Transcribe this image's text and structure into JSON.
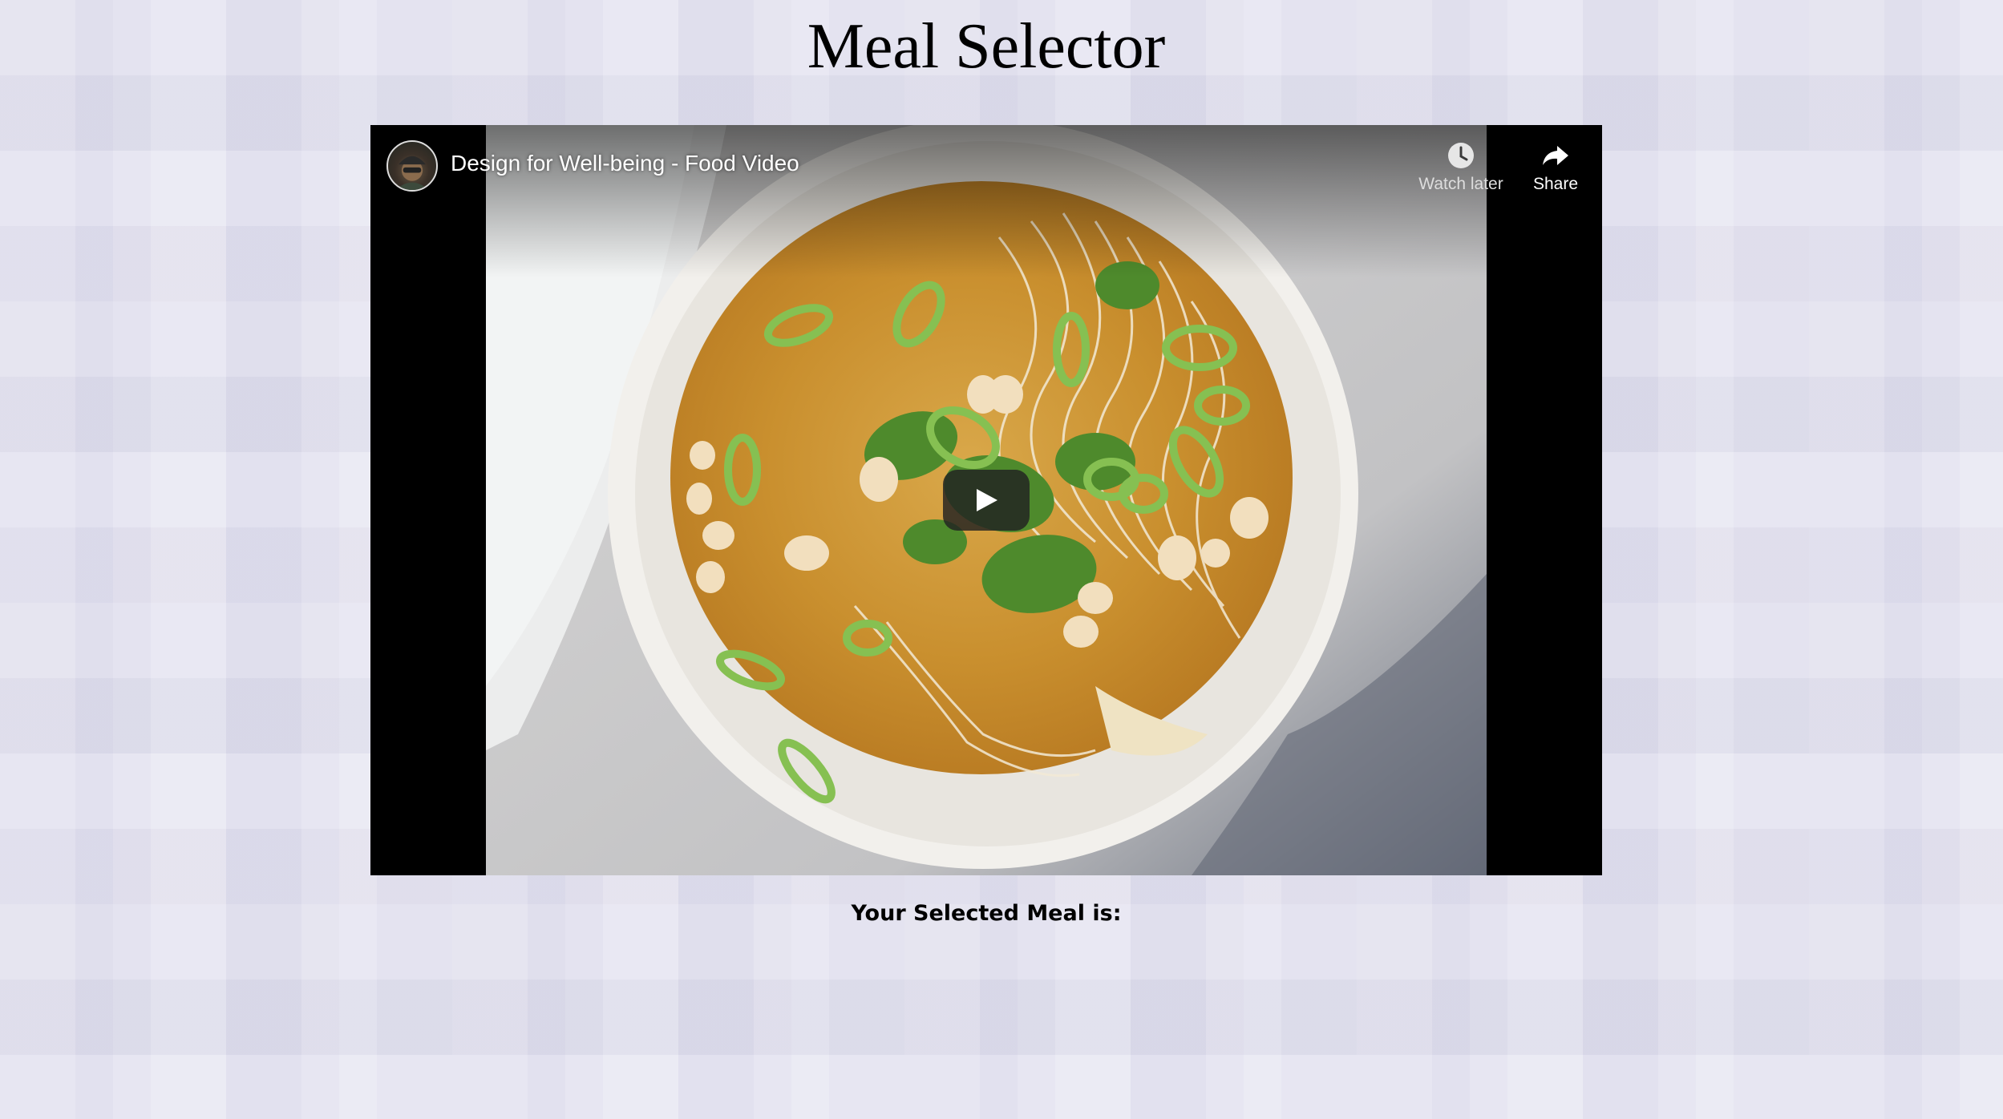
{
  "page": {
    "title": "Meal Selector"
  },
  "video": {
    "title": "Design for Well-being - Food Video",
    "actions": {
      "watch_later": "Watch later",
      "share": "Share"
    },
    "icons": {
      "avatar": "channel-avatar",
      "watch_later": "clock-icon",
      "share": "share-arrow-icon",
      "play": "play-icon"
    }
  },
  "result": {
    "label": "Your Selected Meal is:"
  },
  "colors": {
    "background": "#e4e3f0",
    "video_frame": "#000000",
    "text": "#000000"
  }
}
